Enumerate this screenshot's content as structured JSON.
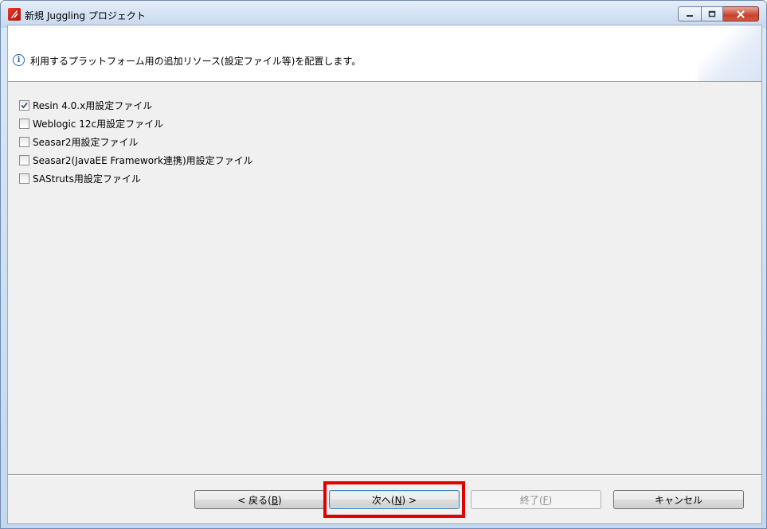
{
  "window": {
    "title": "新規 Juggling プロジェクト",
    "controls": {
      "minimize": "minimize",
      "maximize": "maximize",
      "close": "close"
    }
  },
  "header": {
    "message": "利用するプラットフォーム用の追加リソース(設定ファイル等)を配置します。"
  },
  "options": [
    {
      "label": "Resin 4.0.x用設定ファイル",
      "checked": true
    },
    {
      "label": "Weblogic 12c用設定ファイル",
      "checked": false
    },
    {
      "label": "Seasar2用設定ファイル",
      "checked": false
    },
    {
      "label": "Seasar2(JavaEE Framework連携)用設定ファイル",
      "checked": false
    },
    {
      "label": "SAStruts用設定ファイル",
      "checked": false
    }
  ],
  "buttons": {
    "back": {
      "prefix": "< 戻る(",
      "mnemonic": "B",
      "suffix": ")"
    },
    "next": {
      "prefix": "次へ(",
      "mnemonic": "N",
      "suffix": ") >"
    },
    "finish": {
      "prefix": "終了(",
      "mnemonic": "F",
      "suffix": ")"
    },
    "cancel": {
      "label": "キャンセル"
    }
  },
  "colors": {
    "highlight": "#e00000",
    "accent": "#2b63b5"
  }
}
